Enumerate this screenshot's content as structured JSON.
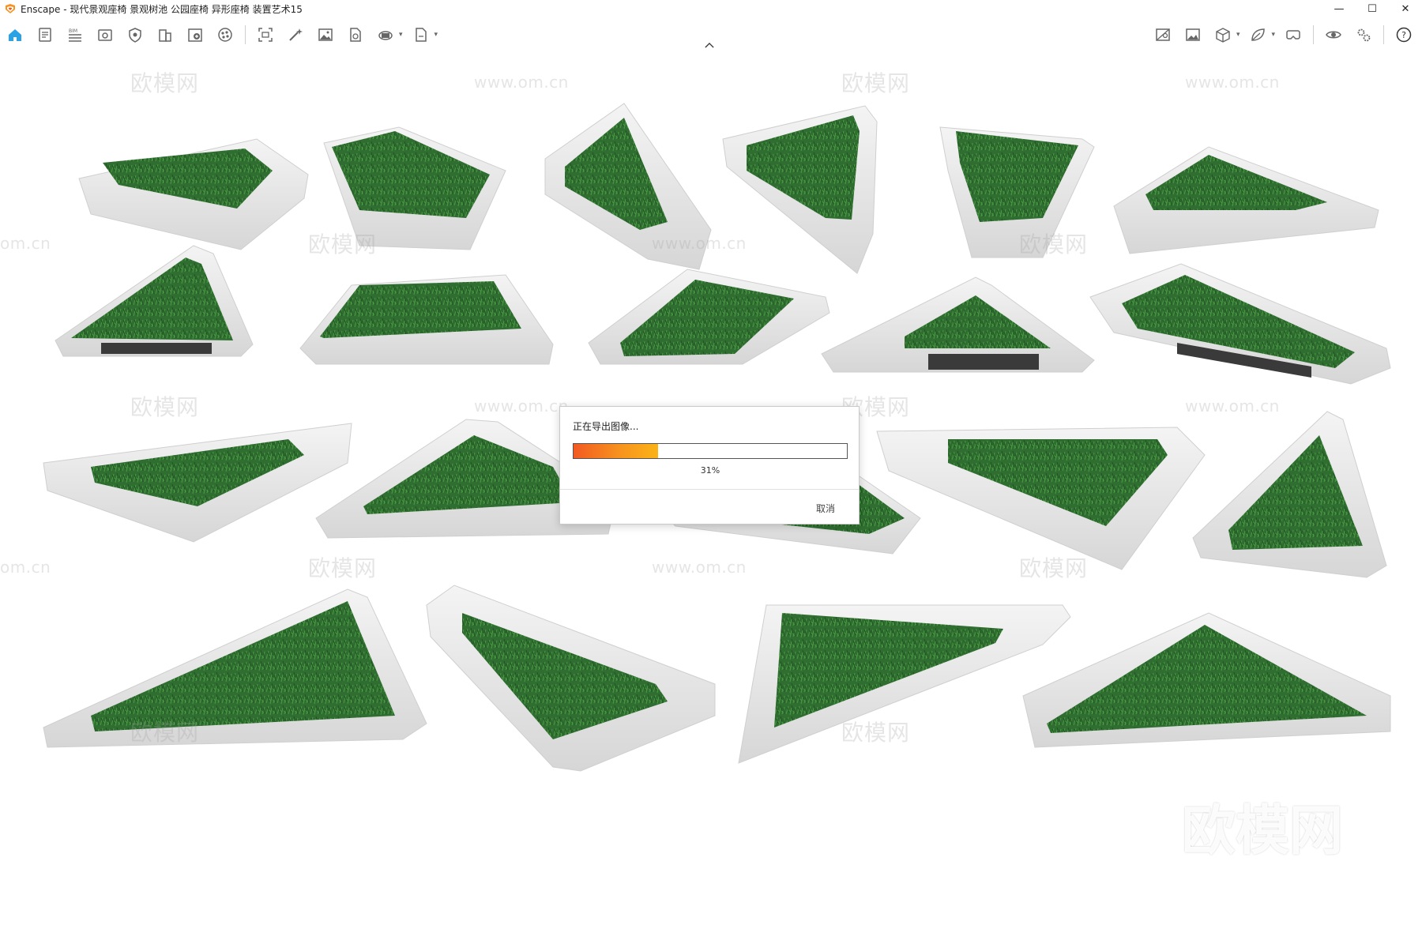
{
  "window": {
    "app_title": "Enscape - 现代景观座椅 景观树池 公园座椅 异形座椅 装置艺术15",
    "minimize_glyph": "—",
    "maximize_glyph": "☐",
    "close_glyph": "✕"
  },
  "toolbar": {
    "left_icons": [
      "home-icon",
      "settings-file-icon",
      "bim-icon",
      "view-icon",
      "shield-icon",
      "building-icon",
      "add-panel-icon",
      "material-icon",
      "screenshot-icon",
      "magic-wand-icon",
      "image-icon",
      "render-file-icon",
      "panorama-icon",
      "export-file-icon"
    ],
    "right_icons": [
      "map-icon",
      "gallery-icon",
      "cube-icon",
      "leaf-icon",
      "vr-headset-icon",
      "eye-icon",
      "settings-icon",
      "help-icon"
    ],
    "collapse_glyph": "^"
  },
  "viewport": {
    "watermarks_cn": "欧模网",
    "watermarks_url": "www.om.cn",
    "watermark_partial": "om.cn",
    "brand_mark": "欧模网"
  },
  "export_dialog": {
    "title": "正在导出图像...",
    "progress_fraction": 0.31,
    "progress_label": "31%",
    "cancel_label": "取消"
  },
  "colors": {
    "accent": "#f7931e",
    "grass": "#2e6b2e",
    "concrete": "#e8e8e8"
  }
}
